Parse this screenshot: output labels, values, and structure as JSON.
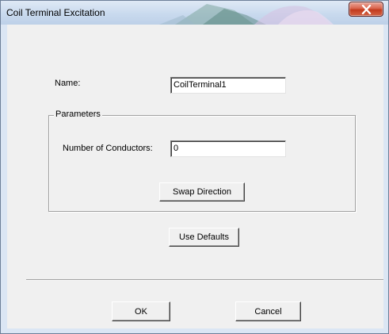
{
  "window": {
    "title": "Coil Terminal Excitation",
    "close_icon": "close-x-icon"
  },
  "form": {
    "name_label": "Name:",
    "name_value": "CoilTerminal1",
    "parameters_group_title": "Parameters",
    "conductors_label": "Number of Conductors:",
    "conductors_value": "0",
    "swap_direction_label": "Swap Direction",
    "use_defaults_label": "Use Defaults"
  },
  "footer": {
    "ok_label": "OK",
    "cancel_label": "Cancel"
  },
  "colors": {
    "dialog_background": "#f0f0f0",
    "window_frame": "#dbe6f4",
    "close_button": "#c23b1e"
  }
}
